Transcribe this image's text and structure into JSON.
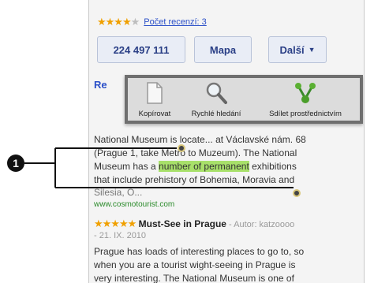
{
  "rating": {
    "stars": "★★★★",
    "star_empty": "★",
    "link": "Počet recenzí: 3"
  },
  "buttons": {
    "phone": "224 497 111",
    "map": "Mapa",
    "more": "Další",
    "more_chevron": "▼"
  },
  "section_heading_partial": "Re",
  "popup": {
    "copy": "Kopírovat",
    "quick_search": "Rychlé hledání",
    "share": "Sdílet prostřednictvím"
  },
  "description": {
    "line1": "National Museum is locate... at Václavské nám. 68",
    "line2": "(Prague 1, take Metro to Muzeum). The National",
    "line3_a": "Museum has a ",
    "line3_selected": "number of permanent",
    "line3_b": " exhibitions",
    "line4": "that include prehistory of Bohemia, Moravia and",
    "line5": "Silesia, O...",
    "url": "www.cosmotourist.com"
  },
  "review": {
    "stars": "★★★★★",
    "title": "Must-See in Prague",
    "author": " - Autor: katzoooo",
    "date": "- 21. IX. 2010",
    "line1": "Prague has loads of interesting places to go to, so",
    "line2": "when you are a tourist wight-seeing in Prague is",
    "line3": "very interesting. The National Museum is one of"
  },
  "callout": {
    "number": "1"
  }
}
